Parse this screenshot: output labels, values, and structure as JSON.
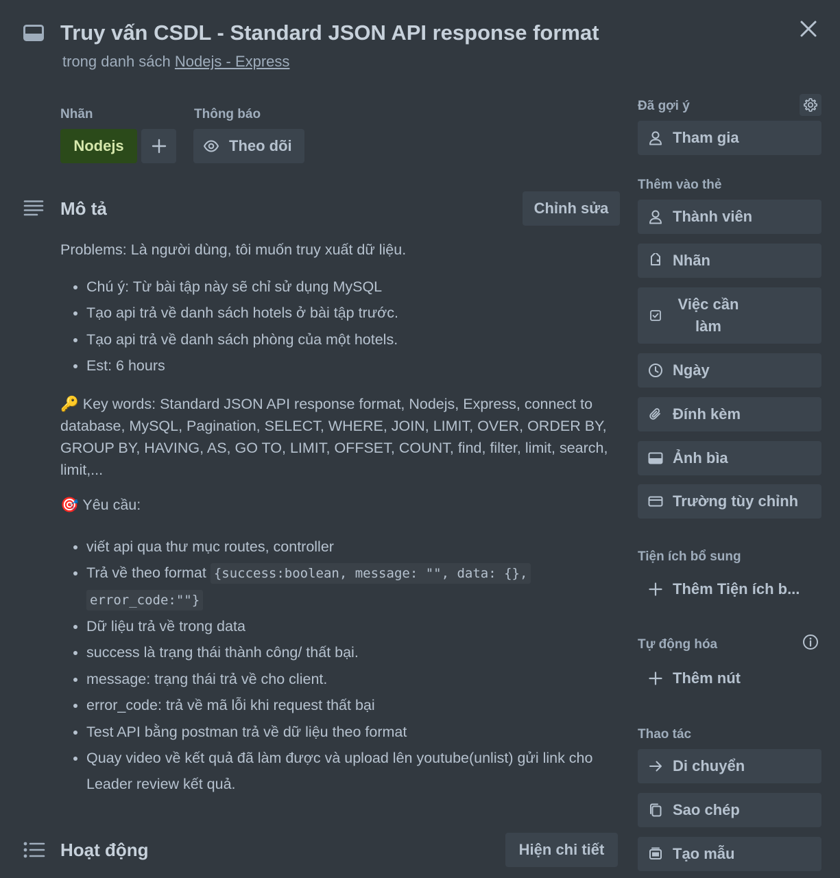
{
  "card": {
    "title": "Truy vấn CSDL - Standard JSON API response format",
    "subtitle_prefix": "trong danh sách ",
    "list_name": "Nodejs - Express"
  },
  "labels": {
    "heading": "Nhãn",
    "items": [
      "Nodejs"
    ],
    "label_color": "#2b4a1a"
  },
  "notifications": {
    "heading": "Thông báo",
    "watch_label": "Theo dõi"
  },
  "description": {
    "heading": "Mô tả",
    "edit_label": "Chỉnh sửa",
    "problems": "Problems: Là người dùng, tôi muốn truy xuất dữ liệu.",
    "bullets1": [
      "Chú ý: Từ bài tập này sẽ chỉ sử dụng MySQL",
      "Tạo api trả về danh sách hotels ở bài tập trước.",
      "Tạo api trả về danh sách phòng của một hotels.",
      "Est: 6 hours"
    ],
    "keywords_emoji": "🔑",
    "keywords": " Key words: Standard JSON API response format, Nodejs, Express, connect to database, MySQL, Pagination, SELECT, WHERE, JOIN, LIMIT, OVER, ORDER BY, GROUP BY, HAVING, AS, GO TO, LIMIT, OFFSET, COUNT, find, filter, limit, search, limit,...",
    "requirements_emoji": "🎯",
    "requirements": " Yêu cầu:",
    "bullets2": [
      "viết api qua thư mục routes, controller",
      "Trả về theo format ",
      "Dữ liệu trả về trong data",
      "success là trạng thái thành công/ thất bại.",
      "message: trạng thái trả về cho client.",
      "error_code: trả về mã lỗi khi request thất bại",
      "Test API bằng postman trả về dữ liệu theo format",
      "Quay video về kết quả đã làm được và upload lên youtube(unlist) gửi link cho Leader review kết quả."
    ],
    "format_code_1": "{success:boolean, message: \"\", data: {},",
    "format_code_2": "error_code:\"\"}"
  },
  "activity": {
    "heading": "Hoạt động",
    "details_label": "Hiện chi tiết"
  },
  "sidebar": {
    "suggested": {
      "heading": "Đã gợi ý",
      "join_label": "Tham gia"
    },
    "add_to_card": {
      "heading": "Thêm vào thẻ",
      "members": "Thành viên",
      "labels": "Nhãn",
      "checklist": "Việc cần làm",
      "dates": "Ngày",
      "attachment": "Đính kèm",
      "cover": "Ảnh bìa",
      "custom_fields": "Trường tùy chỉnh"
    },
    "powerups": {
      "heading": "Tiện ích bổ sung",
      "add_label": "Thêm Tiện ích b..."
    },
    "automation": {
      "heading": "Tự động hóa",
      "add_button_label": "Thêm nút"
    },
    "actions": {
      "heading": "Thao tác",
      "move": "Di chuyển",
      "copy": "Sao chép",
      "template": "Tạo mẫu"
    }
  }
}
